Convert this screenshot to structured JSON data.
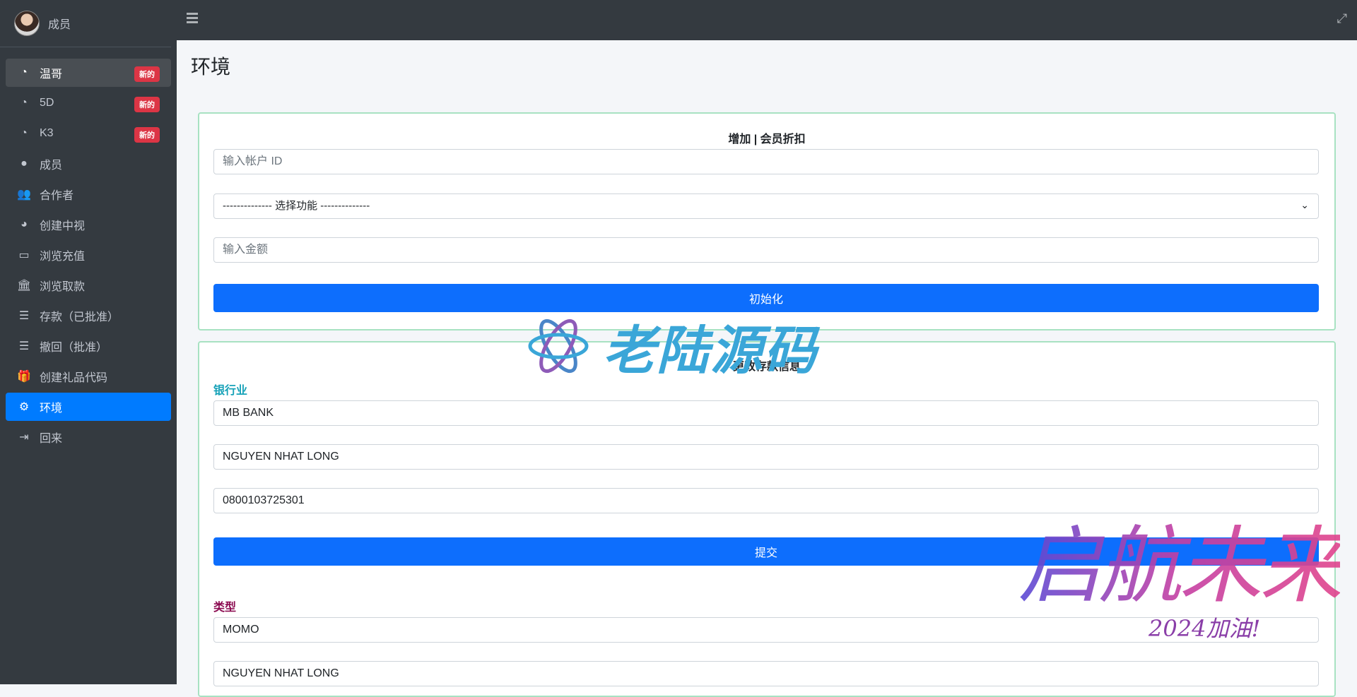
{
  "user": {
    "name": "成员"
  },
  "sidebar": {
    "items": [
      {
        "label": "温哥",
        "badge": "新的",
        "icon": "gauge-icon",
        "glyph": "◔"
      },
      {
        "label": "5D",
        "badge": "新的",
        "icon": "gauge-icon",
        "glyph": "◔"
      },
      {
        "label": "K3",
        "badge": "新的",
        "icon": "gauge-icon",
        "glyph": "◔"
      },
      {
        "label": "成员",
        "badge": "",
        "icon": "user-circle-icon",
        "glyph": "●"
      },
      {
        "label": "合作者",
        "badge": "",
        "icon": "users-icon",
        "glyph": "👥"
      },
      {
        "label": "创建中视",
        "badge": "",
        "icon": "pie-chart-icon",
        "glyph": "◕"
      },
      {
        "label": "浏览充值",
        "badge": "",
        "icon": "credit-card-icon",
        "glyph": "▭"
      },
      {
        "label": "浏览取款",
        "badge": "",
        "icon": "bank-icon",
        "glyph": "🏛"
      },
      {
        "label": "存款（已批准）",
        "badge": "",
        "icon": "list-icon",
        "glyph": "☰"
      },
      {
        "label": "撤回（批准）",
        "badge": "",
        "icon": "list-icon",
        "glyph": "☰"
      },
      {
        "label": "创建礼品代码",
        "badge": "",
        "icon": "gift-icon",
        "glyph": "🎁"
      },
      {
        "label": "环境",
        "badge": "",
        "icon": "gear-icon",
        "glyph": "⚙"
      },
      {
        "label": "回来",
        "badge": "",
        "icon": "sign-out-icon",
        "glyph": "⇥"
      }
    ]
  },
  "page": {
    "title": "环境"
  },
  "discount_form": {
    "title": "增加 | 会员折扣",
    "account_placeholder": "输入帐户 ID",
    "function_select": "-------------- 选择功能 --------------",
    "amount_placeholder": "输入金额",
    "submit": "初始化"
  },
  "deposit_form": {
    "title": "更改存款信息",
    "bank_label": "银行业",
    "bank_name": "MB BANK",
    "bank_holder": "NGUYEN NHAT LONG",
    "bank_account": "0800103725301",
    "submit": "提交",
    "type_label": "类型",
    "type_name": "MOMO",
    "type_holder": "NGUYEN NHAT LONG"
  },
  "watermarks": {
    "brand": "老陆源码",
    "slogan": "启航未来",
    "slogan_sub": "2024加油!"
  },
  "colors": {
    "sidebar_bg": "#343a40",
    "active": "#007bff",
    "badge": "#dc3545",
    "button": "#0d6efd",
    "bank_label": "#17a2b8",
    "type_label": "#8b0a50"
  }
}
